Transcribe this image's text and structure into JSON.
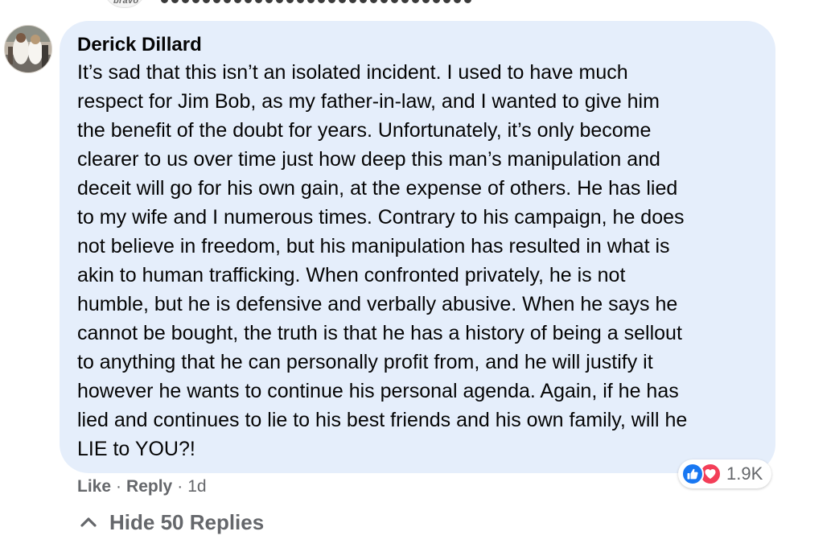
{
  "previous_comment": {
    "avatar_caption": "bravo"
  },
  "comment": {
    "author": "Derick Dillard",
    "lines": [
      "It’s sad that this isn’t an isolated incident. I used to have much",
      "respect for Jim Bob, as my father-in-law, and I wanted to give him",
      "the benefit of the doubt for years. Unfortunately, it’s only become",
      "clearer to us over time just how deep this man’s manipulation and",
      "deceit will go for his own gain, at the expense of others. He has lied",
      "to my wife and I numerous times. Contrary to his campaign, he does",
      "not believe in freedom, but his manipulation has resulted in what is",
      "akin to human trafficking. When confronted privately, he is not",
      "humble, but he is defensive and verbally abusive. When he says he",
      "cannot be bought, the truth is that he has a history of being a sellout",
      "to anything that he can personally profit from, and he will justify it",
      "however he wants to continue his personal agenda. Again, if he has",
      "lied and continues to lie to his best friends and his own family, will he",
      "LIE to YOU?!"
    ],
    "reactions": {
      "icons": [
        "like-icon",
        "love-icon"
      ],
      "count": "1.9K",
      "colors": {
        "like": "#1877f2",
        "love": "#f33e58"
      }
    },
    "actions": {
      "like_label": "Like",
      "reply_label": "Reply",
      "separator": "·",
      "timestamp": "1d"
    }
  },
  "replies_toggle": {
    "label": "Hide 50 Replies",
    "icon": "chevron-up-icon"
  },
  "colors": {
    "bubble_bg": "#e5eefb",
    "secondary_text": "#65676b",
    "primary_text": "#050505"
  }
}
